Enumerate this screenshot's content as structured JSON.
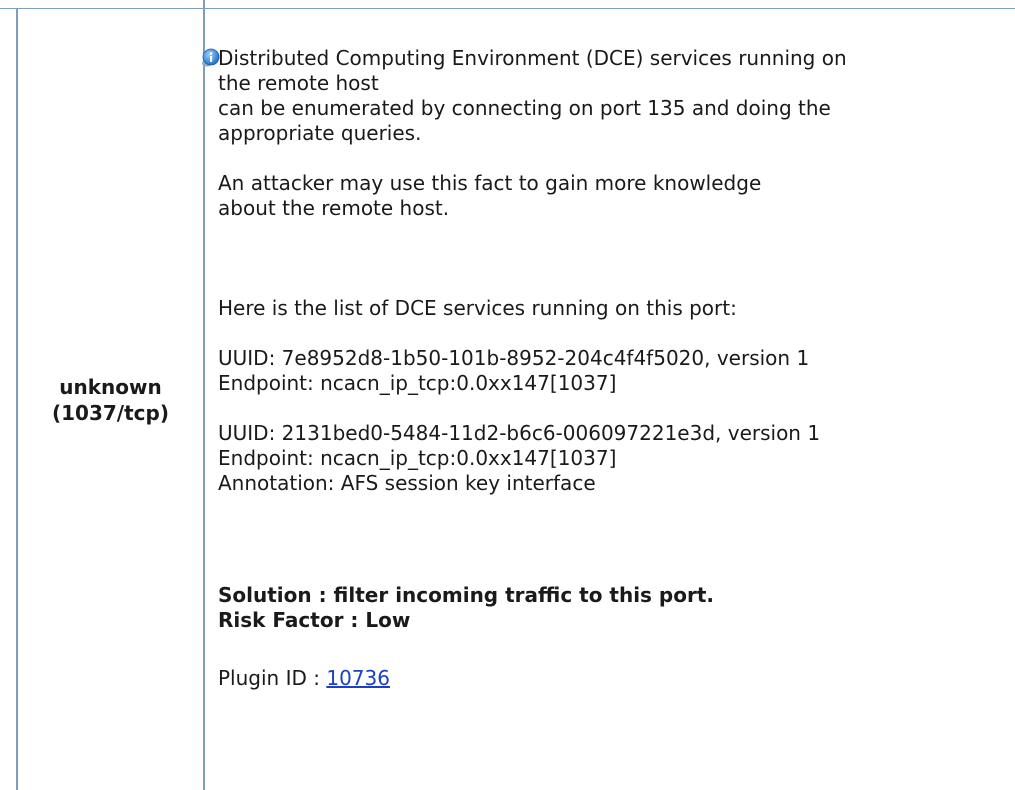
{
  "port": {
    "service": "unknown",
    "port_proto": "(1037/tcp)"
  },
  "icon": {
    "name": "info-icon",
    "color": "#2b7fd6"
  },
  "description": {
    "line1": "Distributed Computing Environment (DCE) services running on",
    "line2": "the remote host",
    "line3": "can be enumerated by connecting on port 135 and doing the",
    "line4": "appropriate queries.",
    "line5": "An attacker may use this fact to gain more knowledge",
    "line6": "about the remote host.",
    "line7": "Here is the list of DCE services running on this port:"
  },
  "services": [
    {
      "uuid_line": "UUID: 7e8952d8-1b50-101b-8952-204c4f4f5020, version 1",
      "endpoint_line": "Endpoint: ncacn_ip_tcp:0.0xx147[1037]"
    },
    {
      "uuid_line": "UUID: 2131bed0-5484-11d2-b6c6-006097221e3d, version 1",
      "endpoint_line": "Endpoint: ncacn_ip_tcp:0.0xx147[1037]",
      "annotation_line": "Annotation: AFS session key interface"
    }
  ],
  "solution": {
    "line1": "Solution : filter incoming traffic to this port.",
    "line2": "Risk Factor : Low"
  },
  "plugin": {
    "label": "Plugin ID : ",
    "id": "10736"
  }
}
